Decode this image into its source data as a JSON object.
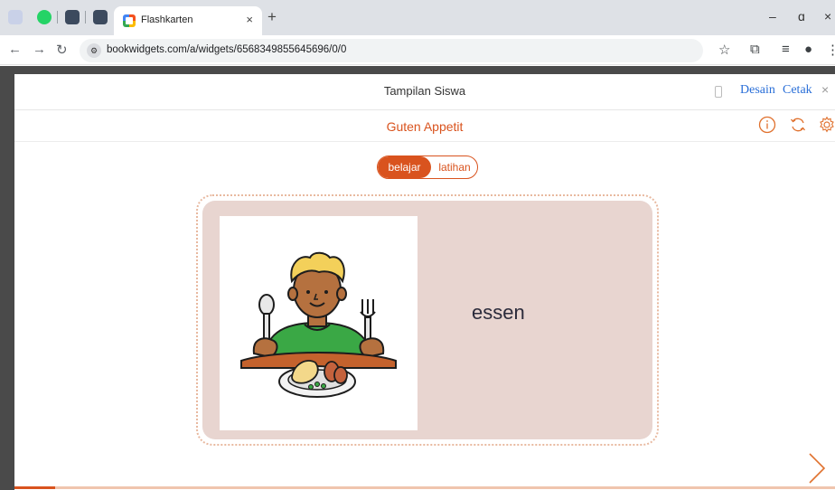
{
  "browser": {
    "tab_title": "Flashkarten",
    "tab_close": "×",
    "new_tab": "+",
    "url": "bookwidgets.com/a/widgets/6568349855645696/0/0",
    "window_controls": [
      "–",
      "ɑ",
      "×"
    ]
  },
  "modal": {
    "title": "Tampilan Siswa",
    "links": [
      "Desain",
      "Cetak"
    ],
    "close": "×"
  },
  "widget": {
    "title": "Guten Appetit",
    "mode_active": "belajar",
    "mode_inactive": "latihan",
    "accent_color": "#d9531e"
  },
  "card": {
    "word": "essen",
    "image_icon": "boy-eating-illustration"
  },
  "progress": {
    "fraction": 0.05
  }
}
